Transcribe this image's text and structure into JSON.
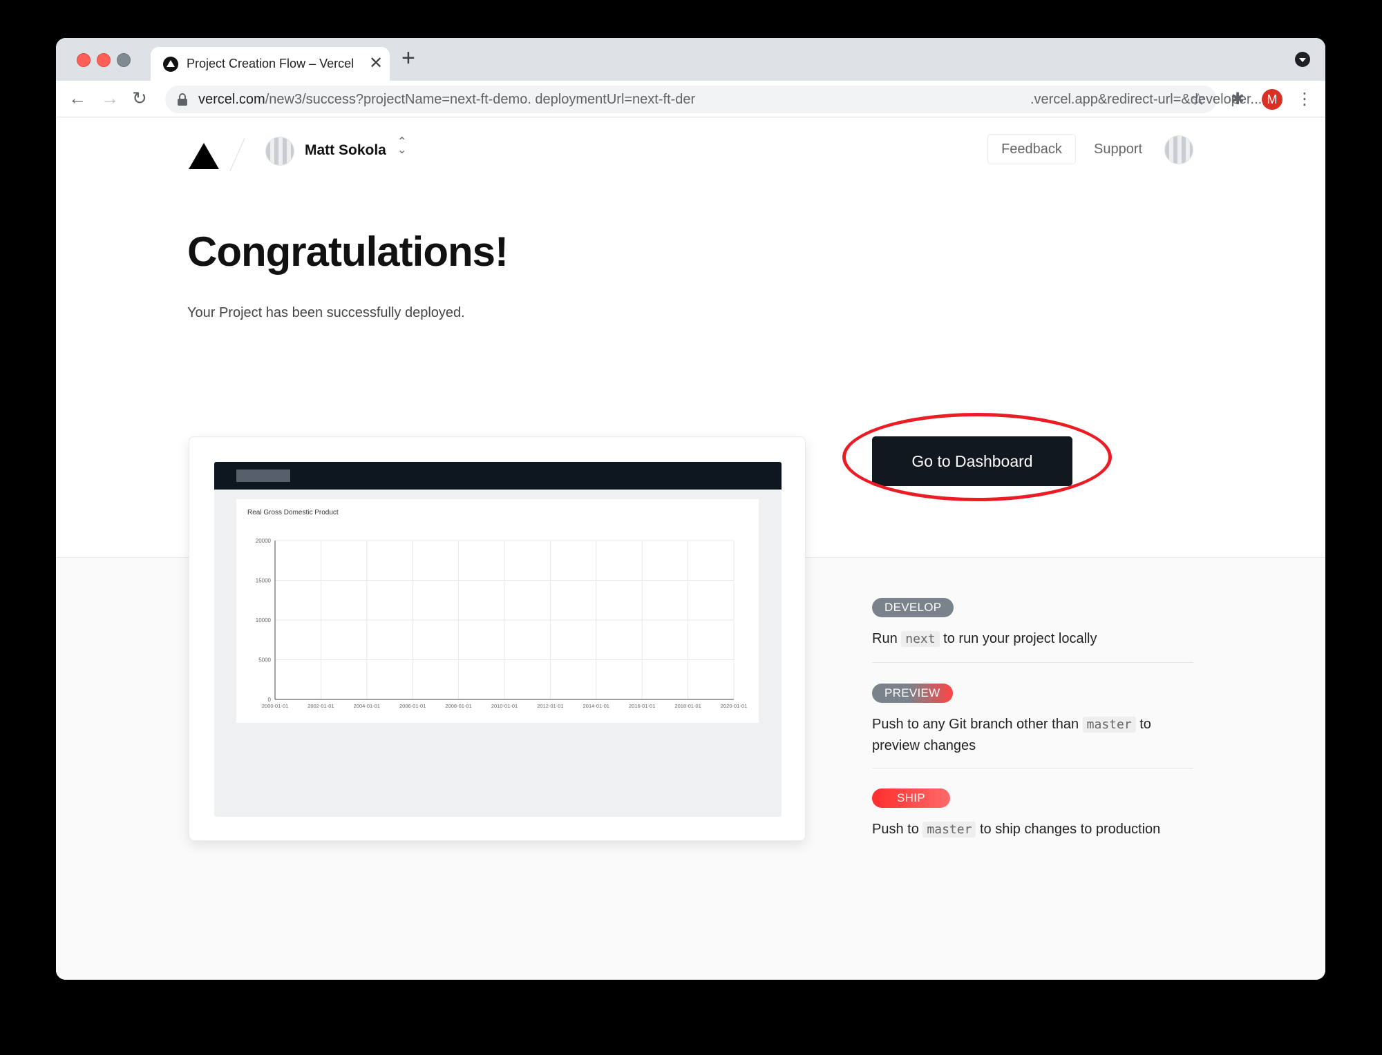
{
  "browser": {
    "tab_title": "Project Creation Flow – Vercel",
    "tab_close": "✕",
    "new_tab": "+",
    "url_host": "vercel.com",
    "url_path": "/new3/success?projectName=next-ft-demo.  deploymentUrl=next-ft-der",
    "url_tail": ".vercel.app&redirect-url=&developer...",
    "profile_initial": "M",
    "icons": [
      "back-arrow",
      "forward-arrow",
      "reload",
      "lock",
      "star",
      "extensions-puzzle",
      "kebab-menu"
    ]
  },
  "header": {
    "team_name": "Matt Sokola",
    "switch_glyph": "⌃\n⌄",
    "feedback_label": "Feedback",
    "support_label": "Support"
  },
  "main": {
    "heading": "Congratulations!",
    "subheading": "Your Project has been successfully deployed.",
    "cta_label": "Go to Dashboard"
  },
  "steps": [
    {
      "badge": "DEVELOP",
      "text_before": "Run ",
      "code": "next",
      "text_after": " to run your project locally"
    },
    {
      "badge": "PREVIEW",
      "text_before": "Push to any Git branch other than ",
      "code": "master",
      "text_after": " to preview changes"
    },
    {
      "badge": "SHIP",
      "text_before": "Push to ",
      "code": "master",
      "text_after": " to ship changes to production"
    }
  ],
  "colors": {
    "cta_bg": "#111820",
    "annotation": "#ec1c24",
    "badge_gray": "#7a838c",
    "badge_red": "#ff2d2d"
  },
  "chart_data": {
    "type": "line",
    "title": "Real Gross Domestic Product",
    "xlabel": "",
    "ylabel": "",
    "categories": [
      "2000-01-01",
      "2002-01-01",
      "2004-01-01",
      "2006-01-01",
      "2008-01-01",
      "2010-01-01",
      "2012-01-01",
      "2014-01-01",
      "2016-01-01",
      "2018-01-01",
      "2020-01-01"
    ],
    "y_ticks": [
      0,
      5000,
      10000,
      15000,
      20000
    ],
    "ylim": [
      0,
      20000
    ],
    "series": [],
    "grid": true
  }
}
